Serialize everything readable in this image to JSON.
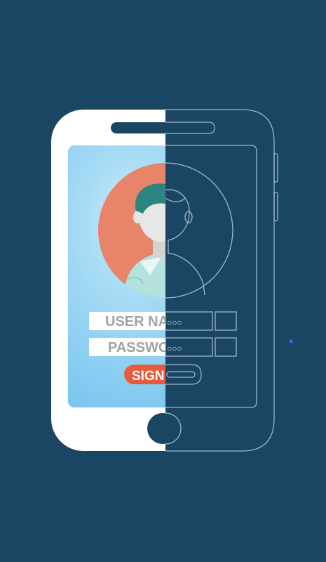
{
  "illustration": {
    "username_label": "USER NA",
    "password_label": "PASSWO",
    "sign_label": "SIGN",
    "username_mask": "○○○",
    "password_mask": "○○○"
  },
  "colors": {
    "background": "#1a4663",
    "phone_body": "#ffffff",
    "screen_light": "#a8dcf5",
    "screen_dark": "#7cc6f0",
    "avatar_circle": "#e8846a",
    "hair": "#2c8580",
    "skin": "#e7e7e7",
    "shirt": "#b3e3dc",
    "button": "#e95a3a",
    "outline": "#9fb6c6",
    "label_text": "#a3a3a3"
  }
}
